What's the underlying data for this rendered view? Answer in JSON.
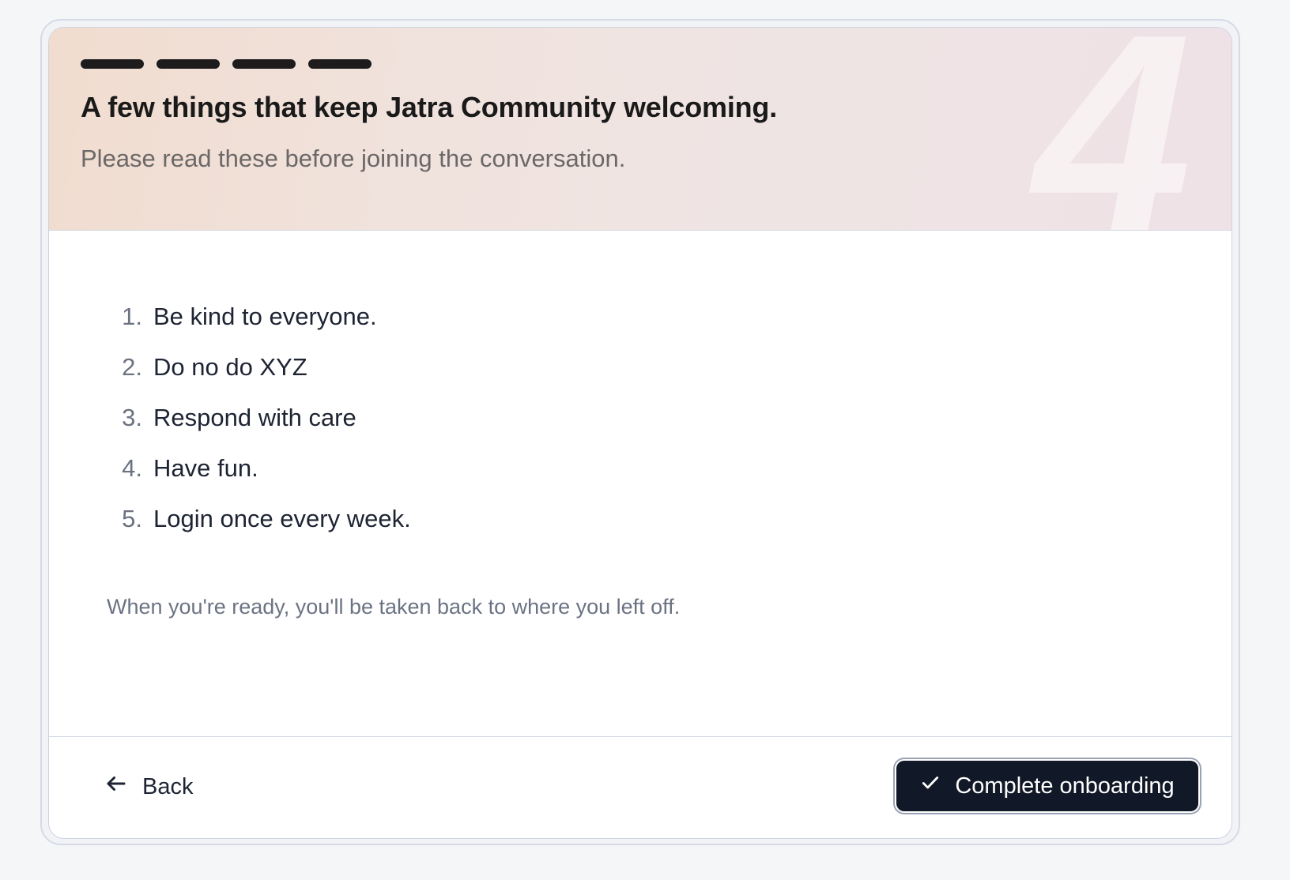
{
  "header": {
    "step_number": "4",
    "progress_segments": 4,
    "title": "A few things that keep Jatra Community welcoming.",
    "subtitle": "Please read these before joining the conversation."
  },
  "rules": [
    {
      "number": "1.",
      "text": "Be kind to everyone."
    },
    {
      "number": "2.",
      "text": "Do no do XYZ"
    },
    {
      "number": "3.",
      "text": "Respond with care"
    },
    {
      "number": "4.",
      "text": "Have fun."
    },
    {
      "number": "5.",
      "text": "Login once every week."
    }
  ],
  "footnote": "When you're ready, you'll be taken back to where you left off.",
  "footer": {
    "back_label": "Back",
    "complete_label": "Complete onboarding"
  },
  "colors": {
    "primary_button": "#111827",
    "progress_active": "#1d1b1c"
  },
  "icons": {
    "back": "arrow-left-icon",
    "complete": "check-icon"
  }
}
